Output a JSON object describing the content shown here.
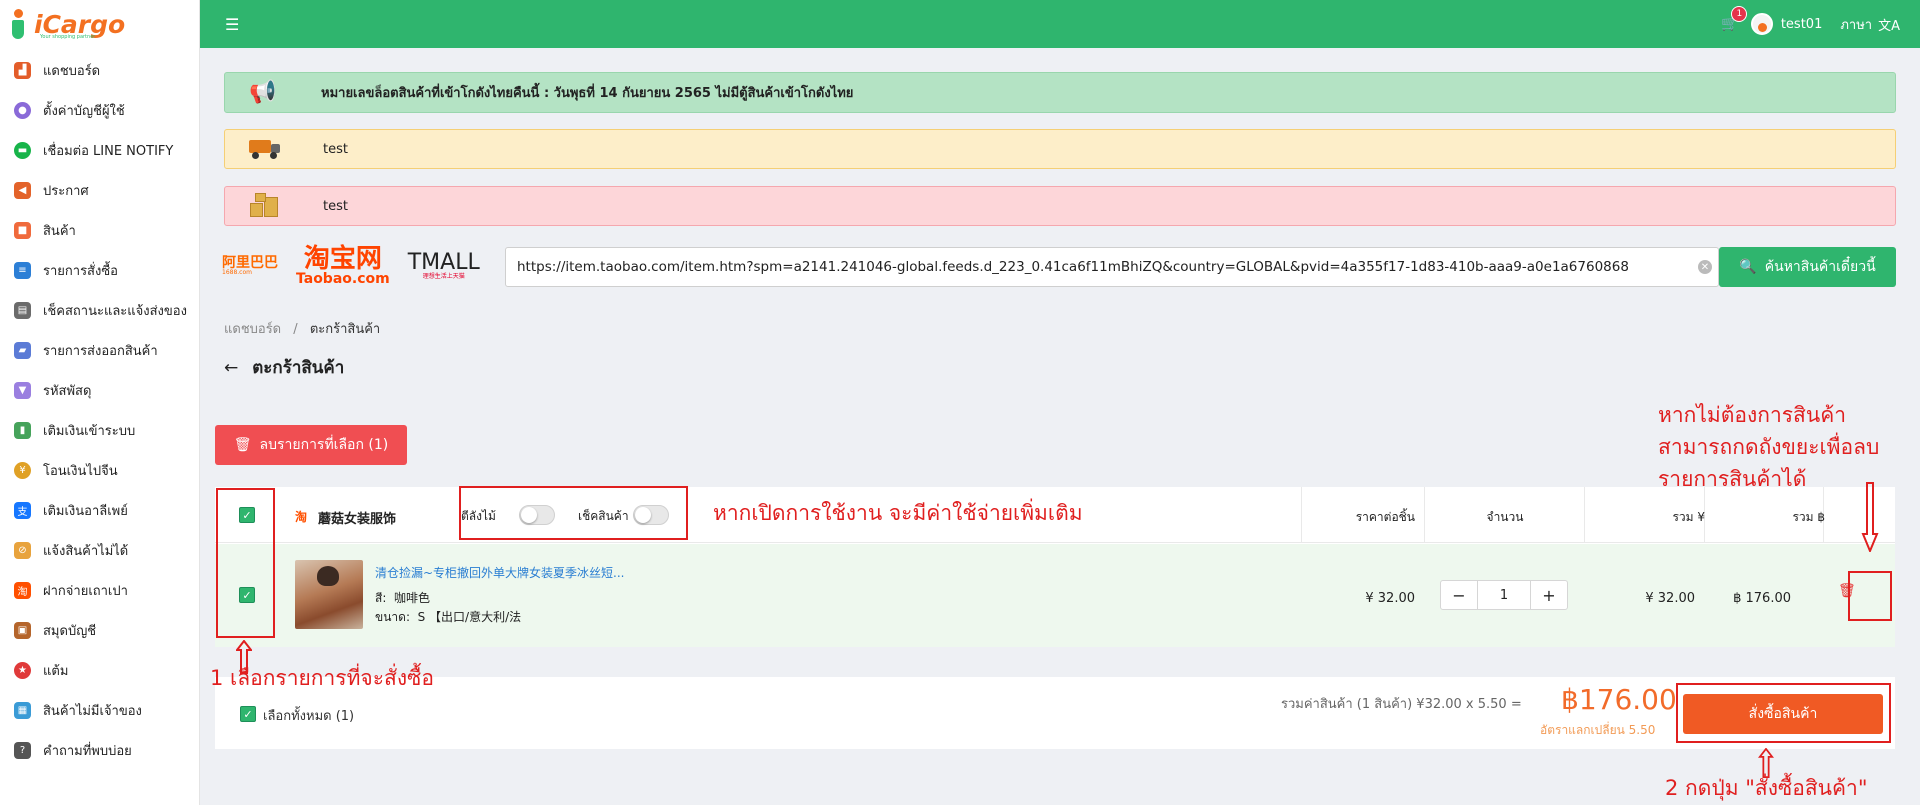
{
  "brand": {
    "name": "iCargo",
    "tagline": "Your shopping partner"
  },
  "sidebar": {
    "items": [
      {
        "label": "แดชบอร์ด",
        "icon": "chart-icon",
        "color": "#e35d2a"
      },
      {
        "label": "ตั้งค่าบัญชีผู้ใช้",
        "icon": "user-settings-icon",
        "color": "#8a6ad8"
      },
      {
        "label": "เชื่อมต่อ LINE NOTIFY",
        "icon": "line-icon",
        "color": "#18b44a"
      },
      {
        "label": "ประกาศ",
        "icon": "megaphone-icon",
        "color": "#e3632a"
      },
      {
        "label": "สินค้า",
        "icon": "bag-icon",
        "color": "#f06a3c"
      },
      {
        "label": "รายการสั่งซื้อ",
        "icon": "orders-icon",
        "color": "#2c7fd6"
      },
      {
        "label": "เช็คสถานะและแจ้งส่งของ",
        "icon": "status-icon",
        "color": "#6b6b6b"
      },
      {
        "label": "รายการส่งออกสินค้า",
        "icon": "truck-icon",
        "color": "#5b7bd6"
      },
      {
        "label": "รหัสพัสดุ",
        "icon": "shirt-icon",
        "color": "#9a7fe0"
      },
      {
        "label": "เติมเงินเข้าระบบ",
        "icon": "phone-icon",
        "color": "#46a35b"
      },
      {
        "label": "โอนเงินไปจีน",
        "icon": "coin-icon",
        "color": "#e0a126"
      },
      {
        "label": "เติมเงินอาลีเพย์",
        "icon": "alipay-icon",
        "color": "#1677ff"
      },
      {
        "label": "แจ้งสินค้าไม่ได้",
        "icon": "warn-icon",
        "color": "#e8a33d"
      },
      {
        "label": "ฝากจ่ายเถาเปา",
        "icon": "taobao-icon",
        "color": "#ff5000"
      },
      {
        "label": "สมุดบัญชี",
        "icon": "book-icon",
        "color": "#b5652b"
      },
      {
        "label": "แต้ม",
        "icon": "points-icon",
        "color": "#e03a3a"
      },
      {
        "label": "สินค้าไม่มีเจ้าของ",
        "icon": "box-icon",
        "color": "#3a9bd6"
      },
      {
        "label": "คำถามที่พบบ่อย",
        "icon": "faq-icon",
        "color": "#555555"
      }
    ]
  },
  "topbar": {
    "cart_count": "1",
    "username": "test01",
    "language_label": "ภาษา",
    "language_icon": "文A"
  },
  "announcements": {
    "main": "หมายเลขล็อตสินค้าที่เข้าโกดังไทยคืนนี้ : วันพุธที่ 14 กันยายน 2565 ไม่มีตู้สินค้าเข้าโกดังไทย",
    "yellow": "test",
    "red": "test"
  },
  "marketplaces": {
    "m1688": "阿里巴巴",
    "m1688_sub": "1688.com",
    "taobao": "淘宝网",
    "taobao_sub": "Taobao.com",
    "tmall": "TMALL",
    "tmall_sub": "理想生活上天猫"
  },
  "search": {
    "value": "https://item.taobao.com/item.htm?spm=a2141.241046-global.feeds.d_223_0.41ca6f11mBhiZQ&country=GLOBAL&pvid=4a355f17-1d83-410b-aaa9-a0e1a6760868",
    "button_label": "ค้นหาสินค้าเดี๋ยวนี้"
  },
  "breadcrumb": {
    "home": "แดชบอร์ด",
    "sep": "/",
    "current": "ตะกร้าสินค้า"
  },
  "page": {
    "title": "ตะกร้าสินค้า"
  },
  "cart": {
    "delete_selected_label": "ลบรายการที่เลือก (1)",
    "shop_icon_text": "淘",
    "shop_name": "蘑菇女装服饰",
    "toggle1_label": "ตีลังไม้",
    "toggle2_label": "เช็คสินค้า",
    "headers": {
      "unit_price": "ราคาต่อชิ้น",
      "quantity": "จำนวน",
      "total_yuan": "รวม ¥",
      "total_baht": "รวม ฿"
    },
    "item": {
      "title": "清仓捡漏~专柜撤回外单大牌女装夏季冰丝短...",
      "color_label": "สี:",
      "color_value": "咖啡色",
      "size_label": "ขนาด:",
      "size_value": "S 【出口/意大利/法",
      "unit_price": "¥ 32.00",
      "quantity": "1",
      "total_yuan": "¥ 32.00",
      "total_baht": "฿ 176.00"
    },
    "footer": {
      "select_all_label": "เลือกทั้งหมด (1)",
      "summary_label": "รวมค่าสินค้า (1 สินค้า)  ¥32.00 x 5.50 =",
      "grand_total": "฿176.00",
      "exchange_rate": "อัตราแลกเปลี่ยน 5.50",
      "order_button": "สั่งซื้อสินค้า"
    }
  },
  "annotations": {
    "toggle_note": "หากเปิดการใช้งาน จะมีค่าใช้จ่ายเพิ่มเติม",
    "trash_note_1": "หากไม่ต้องการสินค้า",
    "trash_note_2": "สามารถกดถังขยะเพื่อลบ",
    "trash_note_3": "รายการสินค้าได้",
    "step1": "1  เลือกรายการที่จะสั่งซื้อ",
    "step2": "2  กดปุ่ม \"สั่งซื้อสินค้า\""
  }
}
